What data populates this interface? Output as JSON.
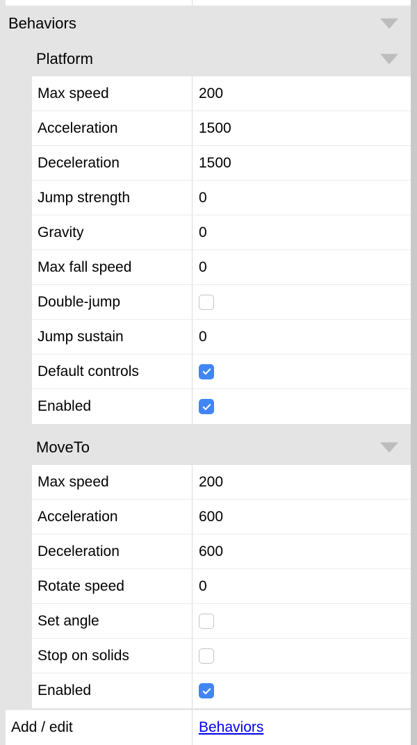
{
  "panel": {
    "title": "Behaviors",
    "collapse_icon": "triangle-down-icon"
  },
  "groups": [
    {
      "name": "Platform",
      "collapse_icon": "triangle-down-icon",
      "rows": [
        {
          "label": "Max speed",
          "type": "text",
          "value": "200"
        },
        {
          "label": "Acceleration",
          "type": "text",
          "value": "1500"
        },
        {
          "label": "Deceleration",
          "type": "text",
          "value": "1500"
        },
        {
          "label": "Jump strength",
          "type": "text",
          "value": "0"
        },
        {
          "label": "Gravity",
          "type": "text",
          "value": "0"
        },
        {
          "label": "Max fall speed",
          "type": "text",
          "value": "0"
        },
        {
          "label": "Double-jump",
          "type": "checkbox",
          "checked": false
        },
        {
          "label": "Jump sustain",
          "type": "text",
          "value": "0"
        },
        {
          "label": "Default controls",
          "type": "checkbox",
          "checked": true
        },
        {
          "label": "Enabled",
          "type": "checkbox",
          "checked": true
        }
      ]
    },
    {
      "name": "MoveTo",
      "collapse_icon": "triangle-down-icon",
      "rows": [
        {
          "label": "Max speed",
          "type": "text",
          "value": "200"
        },
        {
          "label": "Acceleration",
          "type": "text",
          "value": "600"
        },
        {
          "label": "Deceleration",
          "type": "text",
          "value": "600"
        },
        {
          "label": "Rotate speed",
          "type": "text",
          "value": "0"
        },
        {
          "label": "Set angle",
          "type": "checkbox",
          "checked": false
        },
        {
          "label": "Stop on solids",
          "type": "checkbox",
          "checked": false
        },
        {
          "label": "Enabled",
          "type": "checkbox",
          "checked": true
        }
      ]
    }
  ],
  "footer": {
    "label": "Add / edit",
    "link": "Behaviors"
  },
  "colors": {
    "accent": "#4285f4",
    "link": "#0000ee",
    "panel_bg": "#e4e4e4",
    "row_bg": "#ffffff",
    "triangle": "#bdbdbd",
    "scrollbar": "#c9c9c9"
  }
}
